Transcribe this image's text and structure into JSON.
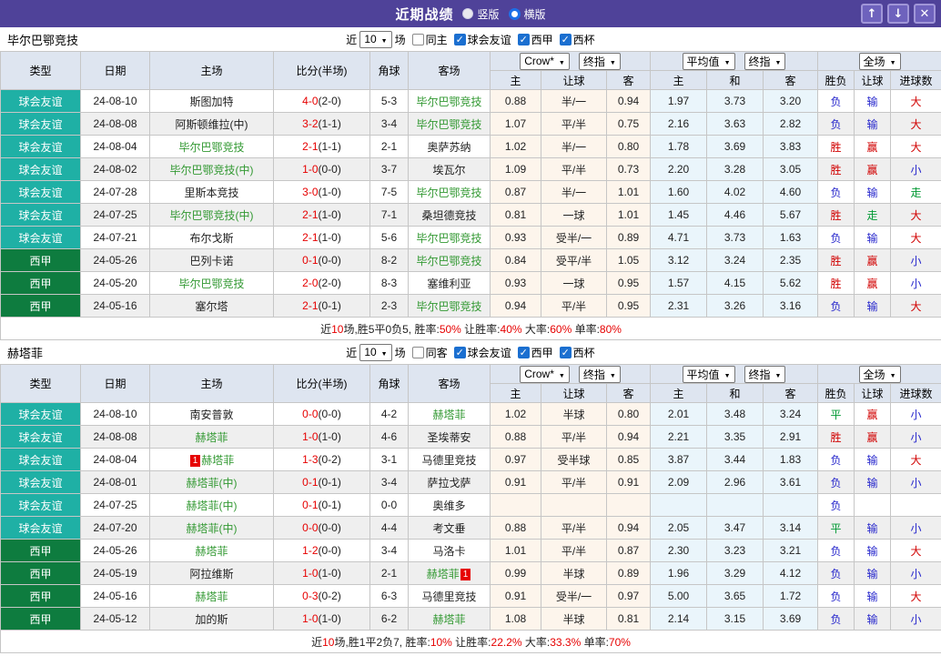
{
  "titlebar": {
    "title": "近期战绩",
    "layout_options": [
      {
        "label": "竖版",
        "selected": false
      },
      {
        "label": "横版",
        "selected": true
      }
    ]
  },
  "colors": {
    "titlebar_bg": "#4f4299",
    "friendly_badge": "#1fb0a5",
    "liga_badge": "#0e7c3f",
    "highlight_team_green": "#339933",
    "score_red": "#e60000",
    "win_red": "#d10000",
    "loss_blue": "#2626cc",
    "draw_green": "#009933",
    "crow_col_bg": "#fdf5ec",
    "avg_col_bg": "#eaf5fb",
    "header_bg": "#dee5f0",
    "checkbox_blue": "#1b6fd0"
  },
  "columns": {
    "type": "类型",
    "date": "日期",
    "home": "主场",
    "score": "比分(半场)",
    "corner": "角球",
    "away": "客场",
    "crow_select": "Crow*",
    "final_select": "终指",
    "avg_select": "平均值",
    "final_select2": "终指",
    "scope_select": "全场",
    "sub": [
      "主",
      "让球",
      "客",
      "主",
      "和",
      "客",
      "胜负",
      "让球",
      "进球数"
    ]
  },
  "sections": [
    {
      "team": "毕尔巴鄂竞技",
      "filters": {
        "near_label": "近",
        "count": "10",
        "games_label": "场",
        "same_label": "同主",
        "same_checked": false,
        "leagues": [
          {
            "label": "球会友谊",
            "checked": true
          },
          {
            "label": "西甲",
            "checked": true
          },
          {
            "label": "西杯",
            "checked": true
          }
        ]
      },
      "rows": [
        {
          "league": "球会友谊",
          "lc": "friendly",
          "date": "24-08-10",
          "home": {
            "name": "斯图加特"
          },
          "ft": "4-0",
          "ht": "(2-0)",
          "corner": "5-3",
          "away": {
            "name": "毕尔巴鄂竞技",
            "hl": true
          },
          "crow": [
            "0.88",
            "半/一",
            "0.94"
          ],
          "avg": [
            "1.97",
            "3.73",
            "3.20"
          ],
          "res": [
            {
              "t": "负",
              "c": "b"
            },
            {
              "t": "输",
              "c": "b"
            },
            {
              "t": "大",
              "c": "r"
            }
          ]
        },
        {
          "league": "球会友谊",
          "lc": "friendly",
          "date": "24-08-08",
          "home": {
            "name": "阿斯顿维拉(中)"
          },
          "ft": "3-2",
          "ht": "(1-1)",
          "corner": "3-4",
          "away": {
            "name": "毕尔巴鄂竞技",
            "hl": true
          },
          "crow": [
            "1.07",
            "平/半",
            "0.75"
          ],
          "avg": [
            "2.16",
            "3.63",
            "2.82"
          ],
          "res": [
            {
              "t": "负",
              "c": "b"
            },
            {
              "t": "输",
              "c": "b"
            },
            {
              "t": "大",
              "c": "r"
            }
          ]
        },
        {
          "league": "球会友谊",
          "lc": "friendly",
          "date": "24-08-04",
          "home": {
            "name": "毕尔巴鄂竞技",
            "hl": true
          },
          "ft": "2-1",
          "ht": "(1-1)",
          "corner": "2-1",
          "away": {
            "name": "奥萨苏纳"
          },
          "crow": [
            "1.02",
            "半/一",
            "0.80"
          ],
          "avg": [
            "1.78",
            "3.69",
            "3.83"
          ],
          "res": [
            {
              "t": "胜",
              "c": "r"
            },
            {
              "t": "赢",
              "c": "r"
            },
            {
              "t": "大",
              "c": "r"
            }
          ]
        },
        {
          "league": "球会友谊",
          "lc": "friendly",
          "date": "24-08-02",
          "home": {
            "name": "毕尔巴鄂竞技(中)",
            "hl": true
          },
          "ft": "1-0",
          "ht": "(0-0)",
          "corner": "3-7",
          "away": {
            "name": "埃瓦尔"
          },
          "crow": [
            "1.09",
            "平/半",
            "0.73"
          ],
          "avg": [
            "2.20",
            "3.28",
            "3.05"
          ],
          "res": [
            {
              "t": "胜",
              "c": "r"
            },
            {
              "t": "赢",
              "c": "r"
            },
            {
              "t": "小",
              "c": "b"
            }
          ]
        },
        {
          "league": "球会友谊",
          "lc": "friendly",
          "date": "24-07-28",
          "home": {
            "name": "里斯本竞技"
          },
          "ft": "3-0",
          "ht": "(1-0)",
          "corner": "7-5",
          "away": {
            "name": "毕尔巴鄂竞技",
            "hl": true
          },
          "crow": [
            "0.87",
            "半/一",
            "1.01"
          ],
          "avg": [
            "1.60",
            "4.02",
            "4.60"
          ],
          "res": [
            {
              "t": "负",
              "c": "b"
            },
            {
              "t": "输",
              "c": "b"
            },
            {
              "t": "走",
              "c": "g"
            }
          ]
        },
        {
          "league": "球会友谊",
          "lc": "friendly",
          "date": "24-07-25",
          "home": {
            "name": "毕尔巴鄂竞技(中)",
            "hl": true
          },
          "ft": "2-1",
          "ht": "(1-0)",
          "corner": "7-1",
          "away": {
            "name": "桑坦德竞技"
          },
          "crow": [
            "0.81",
            "一球",
            "1.01"
          ],
          "avg": [
            "1.45",
            "4.46",
            "5.67"
          ],
          "res": [
            {
              "t": "胜",
              "c": "r"
            },
            {
              "t": "走",
              "c": "g"
            },
            {
              "t": "大",
              "c": "r"
            }
          ]
        },
        {
          "league": "球会友谊",
          "lc": "friendly",
          "date": "24-07-21",
          "home": {
            "name": "布尔戈斯"
          },
          "ft": "2-1",
          "ht": "(1-0)",
          "corner": "5-6",
          "away": {
            "name": "毕尔巴鄂竞技",
            "hl": true
          },
          "crow": [
            "0.93",
            "受半/一",
            "0.89"
          ],
          "avg": [
            "4.71",
            "3.73",
            "1.63"
          ],
          "res": [
            {
              "t": "负",
              "c": "b"
            },
            {
              "t": "输",
              "c": "b"
            },
            {
              "t": "大",
              "c": "r"
            }
          ]
        },
        {
          "league": "西甲",
          "lc": "liga",
          "date": "24-05-26",
          "home": {
            "name": "巴列卡诺"
          },
          "ft": "0-1",
          "ht": "(0-0)",
          "corner": "8-2",
          "away": {
            "name": "毕尔巴鄂竞技",
            "hl": true
          },
          "crow": [
            "0.84",
            "受平/半",
            "1.05"
          ],
          "avg": [
            "3.12",
            "3.24",
            "2.35"
          ],
          "res": [
            {
              "t": "胜",
              "c": "r"
            },
            {
              "t": "赢",
              "c": "r"
            },
            {
              "t": "小",
              "c": "b"
            }
          ]
        },
        {
          "league": "西甲",
          "lc": "liga",
          "date": "24-05-20",
          "home": {
            "name": "毕尔巴鄂竞技",
            "hl": true
          },
          "ft": "2-0",
          "ht": "(2-0)",
          "corner": "8-3",
          "away": {
            "name": "塞维利亚"
          },
          "crow": [
            "0.93",
            "一球",
            "0.95"
          ],
          "avg": [
            "1.57",
            "4.15",
            "5.62"
          ],
          "res": [
            {
              "t": "胜",
              "c": "r"
            },
            {
              "t": "赢",
              "c": "r"
            },
            {
              "t": "小",
              "c": "b"
            }
          ]
        },
        {
          "league": "西甲",
          "lc": "liga",
          "date": "24-05-16",
          "home": {
            "name": "塞尔塔"
          },
          "ft": "2-1",
          "ht": "(0-1)",
          "corner": "2-3",
          "away": {
            "name": "毕尔巴鄂竞技",
            "hl": true
          },
          "crow": [
            "0.94",
            "平/半",
            "0.95"
          ],
          "avg": [
            "2.31",
            "3.26",
            "3.16"
          ],
          "res": [
            {
              "t": "负",
              "c": "b"
            },
            {
              "t": "输",
              "c": "b"
            },
            {
              "t": "大",
              "c": "r"
            }
          ]
        }
      ],
      "summary": [
        {
          "t": "近",
          "c": "k"
        },
        {
          "t": "10",
          "c": "r"
        },
        {
          "t": "场,胜5平0负5, 胜率:",
          "c": "k"
        },
        {
          "t": "50%",
          "c": "r"
        },
        {
          "t": " 让胜率:",
          "c": "k"
        },
        {
          "t": "40%",
          "c": "r"
        },
        {
          "t": " 大率:",
          "c": "k"
        },
        {
          "t": "60%",
          "c": "r"
        },
        {
          "t": " 单率:",
          "c": "k"
        },
        {
          "t": "80%",
          "c": "r"
        }
      ]
    },
    {
      "team": "赫塔菲",
      "filters": {
        "near_label": "近",
        "count": "10",
        "games_label": "场",
        "same_label": "同客",
        "same_checked": false,
        "leagues": [
          {
            "label": "球会友谊",
            "checked": true
          },
          {
            "label": "西甲",
            "checked": true
          },
          {
            "label": "西杯",
            "checked": true
          }
        ]
      },
      "rows": [
        {
          "league": "球会友谊",
          "lc": "friendly",
          "date": "24-08-10",
          "home": {
            "name": "南安普敦"
          },
          "ft": "0-0",
          "ht": "(0-0)",
          "corner": "4-2",
          "away": {
            "name": "赫塔菲",
            "hl": true
          },
          "crow": [
            "1.02",
            "半球",
            "0.80"
          ],
          "avg": [
            "2.01",
            "3.48",
            "3.24"
          ],
          "res": [
            {
              "t": "平",
              "c": "g"
            },
            {
              "t": "赢",
              "c": "r"
            },
            {
              "t": "小",
              "c": "b"
            }
          ]
        },
        {
          "league": "球会友谊",
          "lc": "friendly",
          "date": "24-08-08",
          "home": {
            "name": "赫塔菲",
            "hl": true
          },
          "ft": "1-0",
          "ht": "(1-0)",
          "corner": "4-6",
          "away": {
            "name": "圣埃蒂安"
          },
          "crow": [
            "0.88",
            "平/半",
            "0.94"
          ],
          "avg": [
            "2.21",
            "3.35",
            "2.91"
          ],
          "res": [
            {
              "t": "胜",
              "c": "r"
            },
            {
              "t": "赢",
              "c": "r"
            },
            {
              "t": "小",
              "c": "b"
            }
          ]
        },
        {
          "league": "球会友谊",
          "lc": "friendly",
          "date": "24-08-04",
          "home": {
            "name": "赫塔菲",
            "hl": true,
            "rc": "1",
            "rcpos": "before"
          },
          "ft": "1-3",
          "ht": "(0-2)",
          "corner": "3-1",
          "away": {
            "name": "马德里竞技"
          },
          "crow": [
            "0.97",
            "受半球",
            "0.85"
          ],
          "avg": [
            "3.87",
            "3.44",
            "1.83"
          ],
          "res": [
            {
              "t": "负",
              "c": "b"
            },
            {
              "t": "输",
              "c": "b"
            },
            {
              "t": "大",
              "c": "r"
            }
          ]
        },
        {
          "league": "球会友谊",
          "lc": "friendly",
          "date": "24-08-01",
          "home": {
            "name": "赫塔菲(中)",
            "hl": true
          },
          "ft": "0-1",
          "ht": "(0-1)",
          "corner": "3-4",
          "away": {
            "name": "萨拉戈萨"
          },
          "crow": [
            "0.91",
            "平/半",
            "0.91"
          ],
          "avg": [
            "2.09",
            "2.96",
            "3.61"
          ],
          "res": [
            {
              "t": "负",
              "c": "b"
            },
            {
              "t": "输",
              "c": "b"
            },
            {
              "t": "小",
              "c": "b"
            }
          ]
        },
        {
          "league": "球会友谊",
          "lc": "friendly",
          "date": "24-07-25",
          "home": {
            "name": "赫塔菲(中)",
            "hl": true
          },
          "ft": "0-1",
          "ht": "(0-1)",
          "corner": "0-0",
          "away": {
            "name": "奥维多"
          },
          "crow": [
            "",
            "",
            ""
          ],
          "avg": [
            "",
            "",
            ""
          ],
          "res": [
            {
              "t": "负",
              "c": "b"
            },
            {
              "t": "",
              "c": "b"
            },
            {
              "t": "",
              "c": "b"
            }
          ]
        },
        {
          "league": "球会友谊",
          "lc": "friendly",
          "date": "24-07-20",
          "home": {
            "name": "赫塔菲(中)",
            "hl": true
          },
          "ft": "0-0",
          "ht": "(0-0)",
          "corner": "4-4",
          "away": {
            "name": "考文垂"
          },
          "crow": [
            "0.88",
            "平/半",
            "0.94"
          ],
          "avg": [
            "2.05",
            "3.47",
            "3.14"
          ],
          "res": [
            {
              "t": "平",
              "c": "g"
            },
            {
              "t": "输",
              "c": "b"
            },
            {
              "t": "小",
              "c": "b"
            }
          ]
        },
        {
          "league": "西甲",
          "lc": "liga",
          "date": "24-05-26",
          "home": {
            "name": "赫塔菲",
            "hl": true
          },
          "ft": "1-2",
          "ht": "(0-0)",
          "corner": "3-4",
          "away": {
            "name": "马洛卡"
          },
          "crow": [
            "1.01",
            "平/半",
            "0.87"
          ],
          "avg": [
            "2.30",
            "3.23",
            "3.21"
          ],
          "res": [
            {
              "t": "负",
              "c": "b"
            },
            {
              "t": "输",
              "c": "b"
            },
            {
              "t": "大",
              "c": "r"
            }
          ]
        },
        {
          "league": "西甲",
          "lc": "liga",
          "date": "24-05-19",
          "home": {
            "name": "阿拉维斯"
          },
          "ft": "1-0",
          "ht": "(1-0)",
          "corner": "2-1",
          "away": {
            "name": "赫塔菲",
            "hl": true,
            "rc": "1",
            "rcpos": "after"
          },
          "crow": [
            "0.99",
            "半球",
            "0.89"
          ],
          "avg": [
            "1.96",
            "3.29",
            "4.12"
          ],
          "res": [
            {
              "t": "负",
              "c": "b"
            },
            {
              "t": "输",
              "c": "b"
            },
            {
              "t": "小",
              "c": "b"
            }
          ]
        },
        {
          "league": "西甲",
          "lc": "liga",
          "date": "24-05-16",
          "home": {
            "name": "赫塔菲",
            "hl": true
          },
          "ft": "0-3",
          "ht": "(0-2)",
          "corner": "6-3",
          "away": {
            "name": "马德里竞技"
          },
          "crow": [
            "0.91",
            "受半/一",
            "0.97"
          ],
          "avg": [
            "5.00",
            "3.65",
            "1.72"
          ],
          "res": [
            {
              "t": "负",
              "c": "b"
            },
            {
              "t": "输",
              "c": "b"
            },
            {
              "t": "大",
              "c": "r"
            }
          ]
        },
        {
          "league": "西甲",
          "lc": "liga",
          "date": "24-05-12",
          "home": {
            "name": "加的斯"
          },
          "ft": "1-0",
          "ht": "(1-0)",
          "corner": "6-2",
          "away": {
            "name": "赫塔菲",
            "hl": true
          },
          "crow": [
            "1.08",
            "半球",
            "0.81"
          ],
          "avg": [
            "2.14",
            "3.15",
            "3.69"
          ],
          "res": [
            {
              "t": "负",
              "c": "b"
            },
            {
              "t": "输",
              "c": "b"
            },
            {
              "t": "小",
              "c": "b"
            }
          ]
        }
      ],
      "summary": [
        {
          "t": "近",
          "c": "k"
        },
        {
          "t": "10",
          "c": "r"
        },
        {
          "t": "场,胜1平2负7, 胜率:",
          "c": "k"
        },
        {
          "t": "10%",
          "c": "r"
        },
        {
          "t": " 让胜率:",
          "c": "k"
        },
        {
          "t": "22.2%",
          "c": "r"
        },
        {
          "t": " 大率:",
          "c": "k"
        },
        {
          "t": "33.3%",
          "c": "r"
        },
        {
          "t": " 单率:",
          "c": "k"
        },
        {
          "t": "70%",
          "c": "r"
        }
      ]
    }
  ]
}
